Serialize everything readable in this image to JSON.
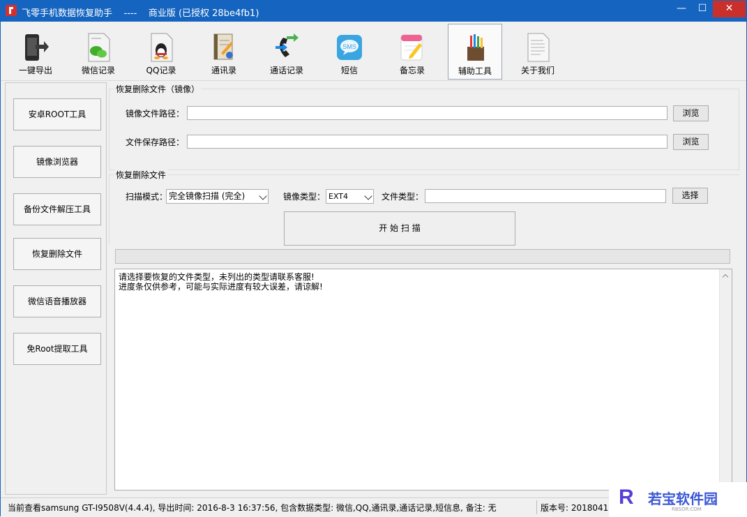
{
  "window": {
    "title": "飞零手机数据恢复助手    ----    商业版 (已授权 28be4fb1)",
    "controls": {
      "minimize": "—",
      "maximize": "☐",
      "close": "✕"
    }
  },
  "toolbar": {
    "items": [
      {
        "label": "一键导出",
        "icon": "phone-export-icon"
      },
      {
        "label": "微信记录",
        "icon": "wechat-doc-icon"
      },
      {
        "label": "QQ记录",
        "icon": "qq-doc-icon"
      },
      {
        "label": "通讯录",
        "icon": "contacts-icon"
      },
      {
        "label": "通话记录",
        "icon": "call-log-icon"
      },
      {
        "label": "短信",
        "icon": "sms-icon"
      },
      {
        "label": "备忘录",
        "icon": "memo-icon"
      },
      {
        "label": "辅助工具",
        "icon": "tools-icon",
        "active": true
      },
      {
        "label": "关于我们",
        "icon": "about-doc-icon"
      }
    ]
  },
  "sidebar": {
    "buttons": [
      "安卓ROOT工具",
      "镜像浏览器",
      "备份文件解压工具",
      "恢复删除文件",
      "微信语音播放器",
      "免Root提取工具"
    ]
  },
  "mirror_group": {
    "title": "恢复删除文件（镜像）",
    "image_path_label": "镜像文件路径：",
    "image_path_value": "",
    "save_path_label": "文件保存路径：",
    "save_path_value": "",
    "browse_label": "浏览"
  },
  "recover_group": {
    "title": "恢复删除文件",
    "scan_mode_label": "扫描模式：",
    "scan_mode_value": "完全镜像扫描 (完全)",
    "image_type_label": "镜像类型：",
    "image_type_value": "EXT4",
    "file_type_label": "文件类型：",
    "file_type_value": "",
    "select_label": "选择",
    "start_label": "开 始 扫 描",
    "progress": 0
  },
  "log": {
    "lines": [
      "请选择要恢复的文件类型，未列出的类型请联系客服!",
      "进度条仅供参考，可能与实际进度有较大误差，请谅解!"
    ]
  },
  "statusbar": {
    "info": "当前查看samsung GT-I9508V(4.4.4), 导出时间: 2016-8-3 16:37:56, 包含数据类型: 微信,QQ,通讯录,通话记录,短信息, 备注: 无",
    "version": "版本号: 2018041"
  },
  "watermark": {
    "logo": "R",
    "text": "若宝软件园",
    "sub": "RBSOR.COM"
  },
  "colors": {
    "titlebar": "#1565c0",
    "close": "#c9302c"
  }
}
